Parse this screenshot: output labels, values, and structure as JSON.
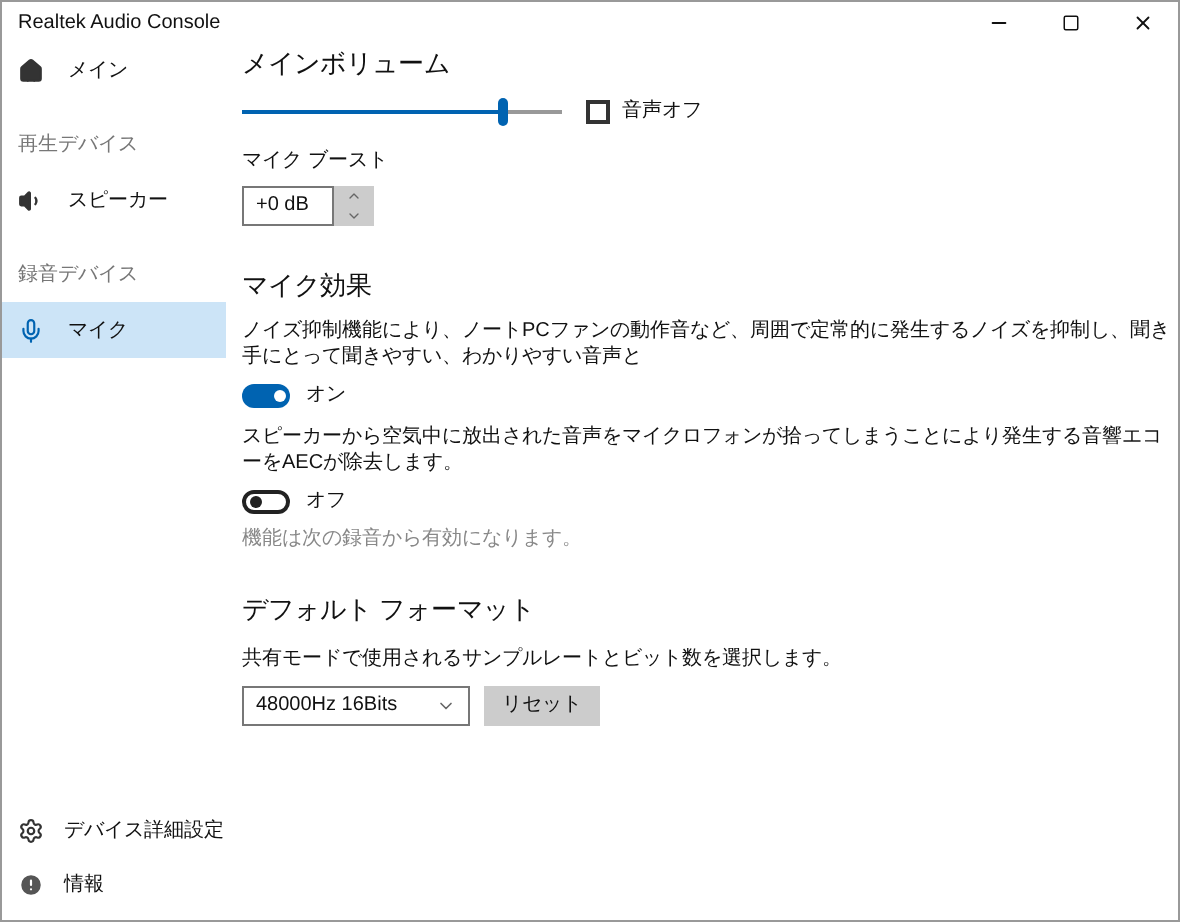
{
  "window": {
    "title": "Realtek Audio Console"
  },
  "sidebar": {
    "items": [
      {
        "kind": "item",
        "label": "メイン",
        "selected": false
      },
      {
        "kind": "header",
        "label": "再生デバイス"
      },
      {
        "kind": "item",
        "label": "スピーカー",
        "selected": false
      },
      {
        "kind": "header",
        "label": "録音デバイス"
      },
      {
        "kind": "item",
        "label": "マイク",
        "selected": true
      }
    ],
    "footer": [
      {
        "label": "デバイス詳細設定"
      },
      {
        "label": "情報"
      }
    ]
  },
  "main_volume": {
    "title": "メインボリューム",
    "level": 0.81,
    "mute": {
      "label": "音声オフ",
      "checked": false
    }
  },
  "mic_boost": {
    "label": "マイク ブースト",
    "value": "+0 dB"
  },
  "mic_effects": {
    "title": "マイク効果",
    "items": [
      {
        "description": "ノイズ抑制機能により、ノートPCファンの動作音など、周囲で定常的に発生するノイズを抑制し、聞き手にとって聞きやすい、わかりやすい音声と",
        "on": true,
        "state_label": "オン"
      },
      {
        "description": "スピーカーから空気中に放出された音声をマイクロフォンが拾ってしまうことにより発生する音響エコーをAECが除去します。",
        "on": false,
        "state_label": "オフ"
      }
    ],
    "note": "機能は次の録音から有効になります。"
  },
  "default_format": {
    "title": "デフォルト フォーマット",
    "description": "共有モードで使用されるサンプルレートとビット数を選択します。",
    "value": "48000Hz 16Bits",
    "reset_button": "リセット"
  }
}
